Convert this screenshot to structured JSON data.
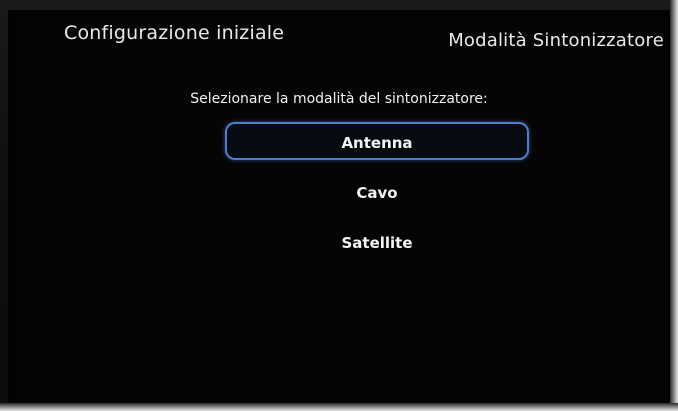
{
  "header": {
    "title": "Configurazione iniziale",
    "section": "Modalità Sintonizzatore"
  },
  "prompt": "Selezionare la modalità del sintonizzatore:",
  "options": [
    {
      "label": "Antenna",
      "selected": true
    },
    {
      "label": "Cavo",
      "selected": false
    },
    {
      "label": "Satellite",
      "selected": false
    }
  ],
  "colors": {
    "highlight_border": "#4a7fd0",
    "text": "#f2f2f2",
    "screen_bg": "#050505"
  }
}
